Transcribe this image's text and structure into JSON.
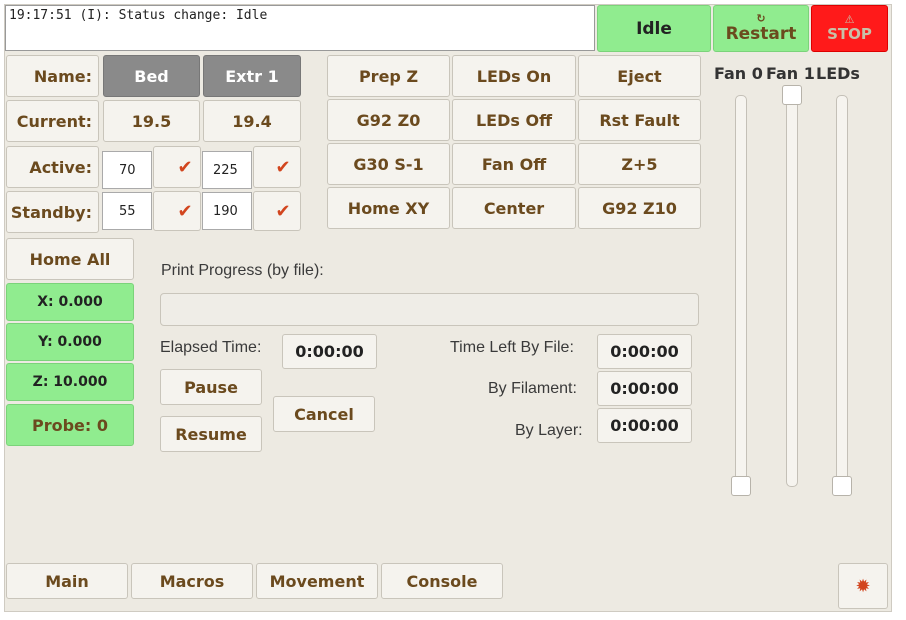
{
  "status": {
    "log": "19:17:51 (I): Status change: Idle",
    "state": "Idle",
    "restart": "Restart",
    "restart_icon": "↻",
    "stop": "STOP",
    "stop_icon": "⚠"
  },
  "heaters": {
    "name_label": "Name:",
    "current_label": "Current:",
    "active_label": "Active:",
    "standby_label": "Standby:",
    "bed": {
      "name": "Bed",
      "current": "19.5",
      "active": "70",
      "standby": "55"
    },
    "extr": {
      "name": "Extr 1",
      "current": "19.4",
      "active": "225",
      "standby": "190"
    },
    "check": "✔"
  },
  "macros": [
    [
      "Prep Z",
      "LEDs On",
      "Eject"
    ],
    [
      "G92 Z0",
      "LEDs Off",
      "Rst Fault"
    ],
    [
      "G30 S-1",
      "Fan Off",
      "Z+5"
    ],
    [
      "Home XY",
      "Center",
      "G92 Z10"
    ]
  ],
  "axes": {
    "home_all": "Home All",
    "x": "X: 0.000",
    "y": "Y: 0.000",
    "z": "Z: 10.000",
    "probe": "Probe: 0"
  },
  "progress": {
    "label": "Print Progress (by file):",
    "percent": 0,
    "elapsed_label": "Elapsed Time:",
    "elapsed": "0:00:00",
    "time_left_file_label": "Time Left By File:",
    "time_left_file": "0:00:00",
    "by_filament_label": "By Filament:",
    "by_filament": "0:00:00",
    "by_layer_label": "By Layer:",
    "by_layer": "0:00:00",
    "pause": "Pause",
    "resume": "Resume",
    "cancel": "Cancel"
  },
  "sliders": {
    "fan0": {
      "label": "Fan 0",
      "value": 0
    },
    "fan1": {
      "label": "Fan 1",
      "value": 100
    },
    "leds": {
      "label": "LEDs",
      "value": 0
    }
  },
  "tabs": [
    "Main",
    "Macros",
    "Movement",
    "Console"
  ],
  "settings_icon": "✹",
  "colors": {
    "accent_text": "#6b4a1e",
    "ok_green": "#90ec8f",
    "stop_red": "#ff1a1a",
    "check": "#d2451e"
  }
}
